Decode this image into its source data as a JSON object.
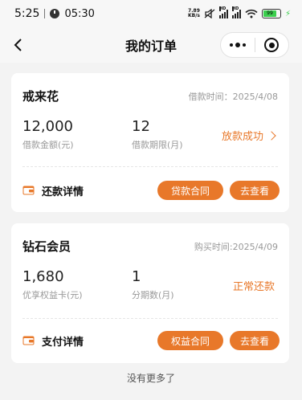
{
  "status_bar": {
    "time": "5:25",
    "clock_time": "05:30",
    "net_speed_value": "7.89",
    "net_speed_unit": "KB/s",
    "hd1": "HD",
    "hd2": "HD",
    "battery": "99"
  },
  "nav": {
    "title": "我的订单"
  },
  "orders": [
    {
      "name": "戒来花",
      "meta": "借款时间：2025/4/08",
      "stat1_value": "12,000",
      "stat1_label": "借款金额(元)",
      "stat2_value": "12",
      "stat2_label": "借款期限(月)",
      "status": "放款成功",
      "detail_label": "还款详情",
      "contract_button": "贷款合同",
      "view_button": "去查看"
    },
    {
      "name": "钻石会员",
      "meta": "购买时间:2025/4/09",
      "stat1_value": "1,680",
      "stat1_label": "优享权益卡(元)",
      "stat2_value": "1",
      "stat2_label": "分期数(月)",
      "status": "正常还款",
      "detail_label": "支付详情",
      "contract_button": "权益合同",
      "view_button": "去查看"
    }
  ],
  "footer": {
    "no_more": "没有更多了"
  },
  "colors": {
    "accent": "#e8782a",
    "background": "#f3f3f3"
  }
}
